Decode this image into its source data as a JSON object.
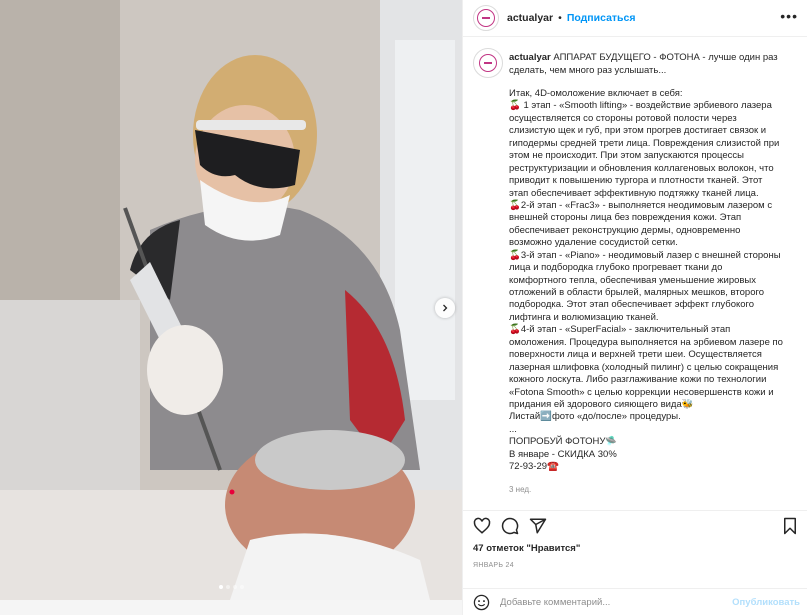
{
  "post": {
    "username": "actualyar",
    "header_separator": "•",
    "follow_label": "Подписаться",
    "more_label": "•••",
    "caption_title": "АППАРАТ БУДУЩЕГО - ФОТОНА - лучше один раз сделать, чем много раз услышать...",
    "caption_lines": [
      "Итак, 4D-омоложение включает в себя:",
      "🍒 1 этап - «Smooth lifting» - воздействие эрбиевого лазера",
      "осуществляется со стороны ротовой полости через",
      "слизистую щек и губ, при этом прогрев достигает связок и",
      "гиподермы средней трети лица. Повреждения слизистой при",
      "этом не происходит. При этом запускаются процессы",
      "реструктуризации и обновления коллагеновых волокон, что",
      "приводит к повышению тургора и плотности тканей. Этот",
      "этап обеспечивает эффективную подтяжку тканей лица.",
      "🍒2-й этап - «Frac3» - выполняется неодимовым лазером с",
      "внешней стороны лица без повреждения кожи. Этап",
      "обеспечивает реконструкцию дермы, одновременно",
      "возможно удаление сосудистой сетки.",
      "🍒3-й этап - «Piano» - неодимовый лазер с внешней стороны",
      "лица и подбородка глубоко прогревает ткани до",
      "комфортного тепла, обеспечивая уменьшение жировых",
      "отложений в области брылей, малярных мешков, второго",
      "подбородка. Этот этап обеспечивает эффект глубокого",
      "лифтинга и волюмизацию тканей.",
      "🍒4-й этап - «SuperFacial» - заключительный этап",
      "омоложения. Процедура выполняется на эрбиевом лазере по",
      "поверхности лица и верхней трети шеи. Осуществляется",
      "лазерная шлифовка (холодный пилинг) с целью сокращения",
      "кожного лоскута. Либо разглаживание кожи по технологии",
      "«Fotona Smooth» с целью коррекции несовершенств кожи и",
      "придания ей здорового сияющего вида🐝",
      "Листай➡️фото «до/после» процедуры.",
      "...",
      "ПОПРОБУЙ ФОТОНУ🛸",
      "В январе - СКИДКА 30%",
      "72-93-29☎️"
    ],
    "caption_age": "3 нед.",
    "likes_text": "47 отметок \"Нравится\"",
    "date_text": "Январь 24",
    "comment_placeholder": "Добавьте комментарий...",
    "publish_label": "Опубликовать"
  },
  "carousel": {
    "current_slide": 1,
    "total_slides": 4
  },
  "icons": {
    "header_avatar": "brand-logo-avatar",
    "like": "heart-icon",
    "comment": "comment-icon",
    "share": "paper-plane-icon",
    "save": "bookmark-icon",
    "emoji": "smiley-icon",
    "next": "chevron-right-icon"
  },
  "colors": {
    "link_blue": "#0095f6",
    "publish_disabled": "#b2dffc",
    "brand_magenta": "#c13584",
    "border": "#efefef",
    "secondary_text": "#8e8e8e"
  }
}
